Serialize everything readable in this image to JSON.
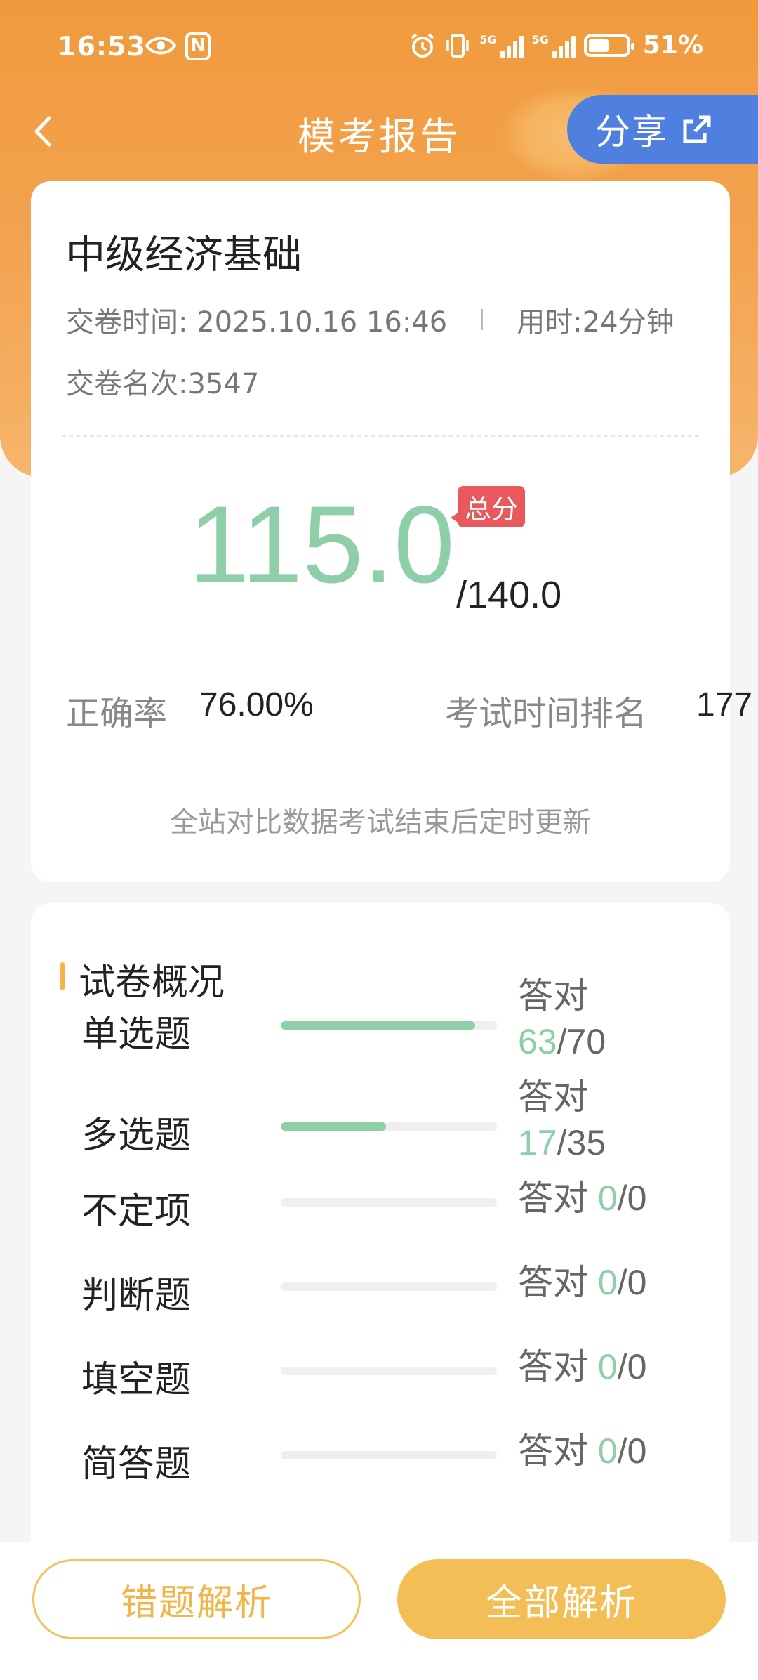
{
  "status_bar": {
    "time": "16:53",
    "battery": "51%",
    "sig1": "5G",
    "sig2": "5G"
  },
  "nav": {
    "title": "模考报告",
    "share_label": "分享"
  },
  "report": {
    "exam_name": "中级经济基础",
    "submit_time": "交卷时间: 2025.10.16 16:46",
    "duration": "用时:24分钟",
    "submit_rank": "交卷名次:3547",
    "score": "115.0",
    "total": "/140.0",
    "total_badge": "总分",
    "accuracy_label": "正确率",
    "accuracy_value": "76.00%",
    "rank_label": "考试时间排名",
    "rank_value": "177",
    "note": "全站对比数据考试结束后定时更新"
  },
  "overview": {
    "title": "试卷概况",
    "answered_label": "答对",
    "rows": [
      {
        "name": "单选题",
        "correct": "63",
        "total": "/70",
        "progress": 0.9
      },
      {
        "name": "多选题",
        "correct": "17",
        "total": "/35",
        "progress": 0.486
      },
      {
        "name": "不定项",
        "correct": "0",
        "total": "/0",
        "progress": 0
      },
      {
        "name": "判断题",
        "correct": "0",
        "total": "/0",
        "progress": 0
      },
      {
        "name": "填空题",
        "correct": "0",
        "total": "/0",
        "progress": 0
      },
      {
        "name": "简答题",
        "correct": "0",
        "total": "/0",
        "progress": 0
      }
    ]
  },
  "actions": {
    "wrong_analysis": "错题解析",
    "all_analysis": "全部解析"
  },
  "colors": {
    "accent_orange": "#f09a3c",
    "score_green": "#8fcfa8",
    "share_blue": "#4f80df",
    "badge_red": "#e9585a"
  }
}
